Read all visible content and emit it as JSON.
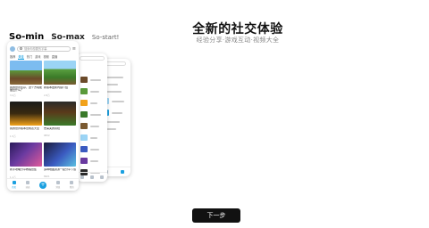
{
  "header": {
    "title": "全新的社交体验",
    "subtitle": "经验分享·游戏互动·视频大全"
  },
  "modes": [
    {
      "label": "So-min"
    },
    {
      "label": "So-max"
    },
    {
      "label": "So-start!"
    }
  ],
  "front_phone": {
    "search_placeholder": "搜索你想要的字幕",
    "tabs": [
      "推荐",
      "关注",
      "热门",
      "游戏",
      "视频",
      "直播"
    ],
    "cards": [
      {
        "title": "我的世界生存，这个方块能做出什么？",
        "meta": "3.2万"
      },
      {
        "title": "新版本更新内容介绍",
        "meta": "2.8万"
      },
      {
        "title": "我的世界版本合成表大全",
        "meta": "1.5万"
      },
      {
        "title": "史蒂夫的冒险",
        "meta": "9832"
      },
      {
        "title": "新手攻略分享教程合集",
        "meta": "1.1万"
      },
      {
        "title": "多种地图资源一起分享下载",
        "meta": "8921"
      }
    ],
    "nav": [
      {
        "label": "首页",
        "icon": "home-icon"
      },
      {
        "label": "动态",
        "icon": "feed-icon"
      },
      {
        "label": "+",
        "icon": "plus-icon"
      },
      {
        "label": "消息",
        "icon": "message-icon"
      },
      {
        "label": "我的",
        "icon": "profile-icon"
      }
    ]
  },
  "next_button": {
    "label": "下一步"
  }
}
